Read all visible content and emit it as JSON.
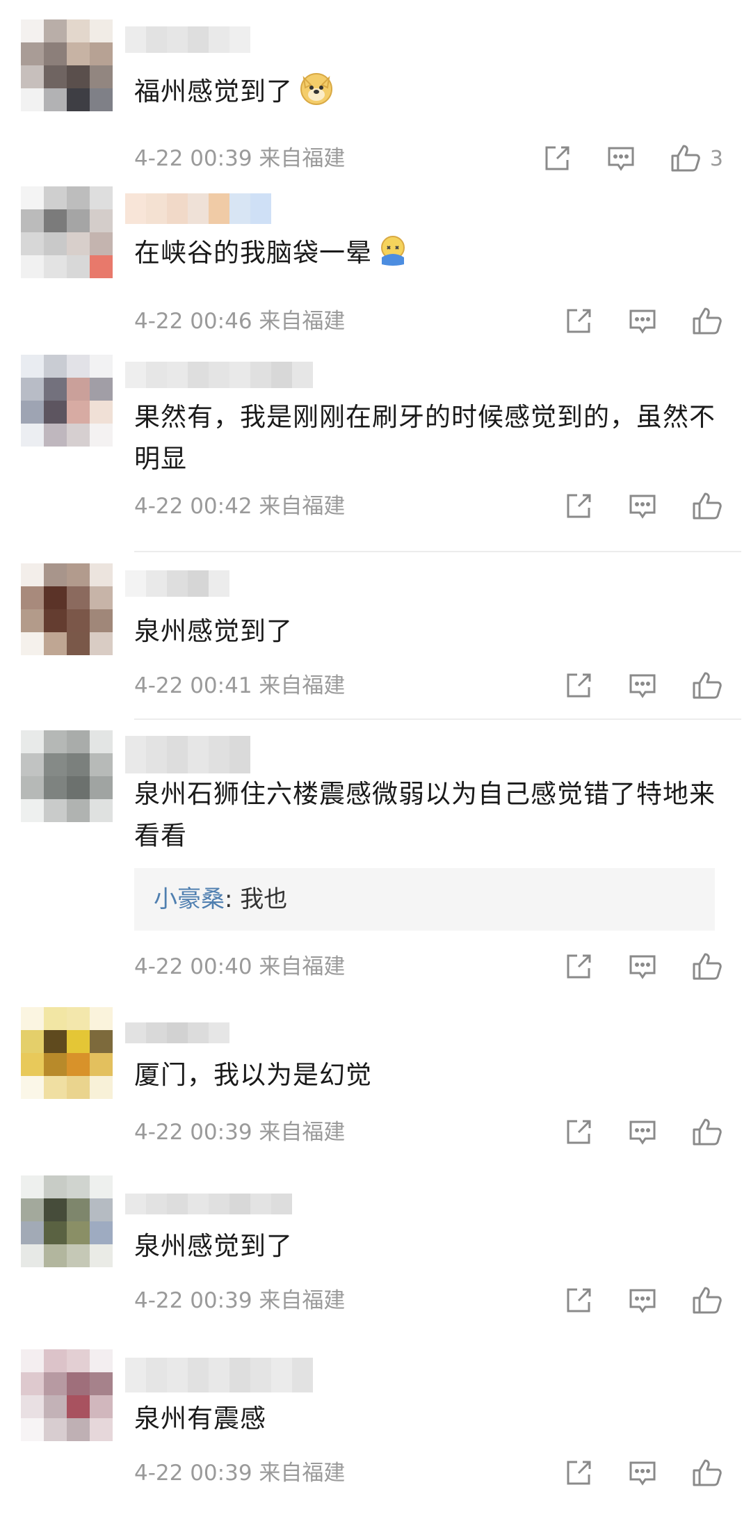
{
  "comments": [
    {
      "text": "福州感觉到了",
      "emoji": "doge-emoji",
      "meta": "4-22 00:39 来自福建",
      "likes": "3",
      "avatar_colors": [
        "#f4f1ef",
        "#b9aea8",
        "#e3d7cc",
        "#f1ece6",
        "#a99c96",
        "#8c7f7a",
        "#c7b3a4",
        "#b7a294",
        "#c7bfbc",
        "#6f6461",
        "#5a4f4c",
        "#928680",
        "#f2f2f2",
        "#b2b2b4",
        "#3e3e44",
        "#7f8087"
      ],
      "name_colors": [
        "#ececec",
        "#e2e2e2",
        "#e6e6e6",
        "#dedede",
        "#e9e9e9",
        "#efefef"
      ]
    },
    {
      "text": "在峡谷的我脑袋一晕",
      "emoji": "dizzy-emoji",
      "meta": "4-22 00:46 来自福建",
      "avatar_colors": [
        "#f4f4f4",
        "#cfcfcf",
        "#bdbdbd",
        "#dedede",
        "#bbbbbb",
        "#7b7b7b",
        "#a5a5a5",
        "#d4cdca",
        "#d7d7d7",
        "#c9c9c9",
        "#d8cfcb",
        "#c4b4af",
        "#f1f1f1",
        "#e3e3e3",
        "#d8d8d8",
        "#e8796b"
      ],
      "name_colors": [
        "#f8e5d8",
        "#f4e1d2",
        "#f1d9c8",
        "#efe1d7",
        "#f0cba6",
        "#d8e5f4",
        "#cfe0f6"
      ]
    },
    {
      "text": "果然有，我是刚刚在刷牙的时候感觉到的，虽然不明显",
      "meta": "4-22 00:42 来自福建",
      "avatar_colors": [
        "#e9ecf1",
        "#c9ccd3",
        "#e2e2e7",
        "#f2f2f3",
        "#b8bcc6",
        "#73717d",
        "#caa09a",
        "#a19ea6",
        "#9ea4b3",
        "#5d5560",
        "#d7aba3",
        "#f0e0d6",
        "#eceef2",
        "#bfb7be",
        "#d6cfd0",
        "#f4f2f2"
      ],
      "name_colors": [
        "#eeeeee",
        "#e6e6e6",
        "#e9e9e9",
        "#dedede",
        "#e4e4e4",
        "#e9e9e9",
        "#e0e0e0",
        "#d8d8d8",
        "#e6e6e6"
      ]
    },
    {
      "text": "泉州感觉到了",
      "meta": "4-22 00:41 来自福建",
      "avatar_colors": [
        "#f3eeea",
        "#a8958b",
        "#b29b8d",
        "#ece4de",
        "#a88a7c",
        "#5b3328",
        "#8b6a5e",
        "#c7b4a8",
        "#b39b8a",
        "#643d30",
        "#7b5749",
        "#a08779",
        "#f5f1ec",
        "#bfa693",
        "#7a5849",
        "#d9ccc4"
      ],
      "name_colors": [
        "#f3f3f3",
        "#e9e9e9",
        "#dedede",
        "#d6d6d6",
        "#ececec"
      ]
    },
    {
      "text": "泉州石狮住六楼震感微弱以为自己感觉错了特地来看看",
      "meta": "4-22 00:40 来自福建",
      "reply_name": "小豪桑",
      "reply_text": ": 我也",
      "avatar_colors": [
        "#e8eae9",
        "#b5b8b6",
        "#a9acaa",
        "#e3e5e4",
        "#c1c3c2",
        "#858a87",
        "#7b807d",
        "#b7bab8",
        "#b6b9b7",
        "#7e8380",
        "#6c716e",
        "#a0a4a2",
        "#eef0ef",
        "#c9cbca",
        "#b0b3b1",
        "#dfe1e0"
      ],
      "name_colors": [
        "#e9e9e9",
        "#e3e3e3",
        "#dddddd",
        "#e6e6e6",
        "#e0e0e0",
        "#dadada"
      ]
    },
    {
      "text": "厦门，我以为是幻觉",
      "meta": "4-22 00:39 来自福建",
      "avatar_colors": [
        "#fbf5e1",
        "#f2e6a4",
        "#f3e7ac",
        "#faf3dc",
        "#e4cf6a",
        "#5f4a1e",
        "#e4c636",
        "#7d6a3c",
        "#e8c95a",
        "#b88a2a",
        "#d8922a",
        "#e3c05e",
        "#fbf7e8",
        "#f0dfa2",
        "#ead48e",
        "#f8f1d8"
      ],
      "name_colors": [
        "#e2e2e2",
        "#d9d9d9",
        "#d2d2d2",
        "#dcdcdc",
        "#e6e6e6"
      ]
    },
    {
      "text": "泉州感觉到了",
      "meta": "4-22 00:39 来自福建",
      "avatar_colors": [
        "#eef0ee",
        "#c8ccc6",
        "#d0d4cf",
        "#eef0ee",
        "#a3a99c",
        "#464c3a",
        "#7e866c",
        "#b5bbc2",
        "#a2aab6",
        "#5a6242",
        "#8a8f66",
        "#9eabc1",
        "#e7e9e6",
        "#b2b69e",
        "#c5c8b6",
        "#eaebe6"
      ],
      "name_colors": [
        "#e9e9e9",
        "#e2e2e2",
        "#dddddd",
        "#e6e6e6",
        "#e0e0e0",
        "#d8d8d8",
        "#e3e3e3",
        "#dddddd"
      ]
    },
    {
      "text": "泉州有震感",
      "meta": "4-22 00:39 来自福建",
      "avatar_colors": [
        "#f4eef0",
        "#dcc3c9",
        "#e3cfd3",
        "#f3eef0",
        "#dec9ce",
        "#b79aa2",
        "#9f6f7b",
        "#a6828b",
        "#e9e0e3",
        "#c3b2b7",
        "#a8525f",
        "#d1b7bd",
        "#f7f4f5",
        "#d8cdd0",
        "#bfb0b4",
        "#e6d7da"
      ],
      "name_colors": [
        "#ececec",
        "#e5e5e5",
        "#e9e9e9",
        "#e1e1e1",
        "#e8e8e8",
        "#dedede",
        "#e4e4e4",
        "#ebebeb",
        "#e2e2e2"
      ]
    }
  ]
}
